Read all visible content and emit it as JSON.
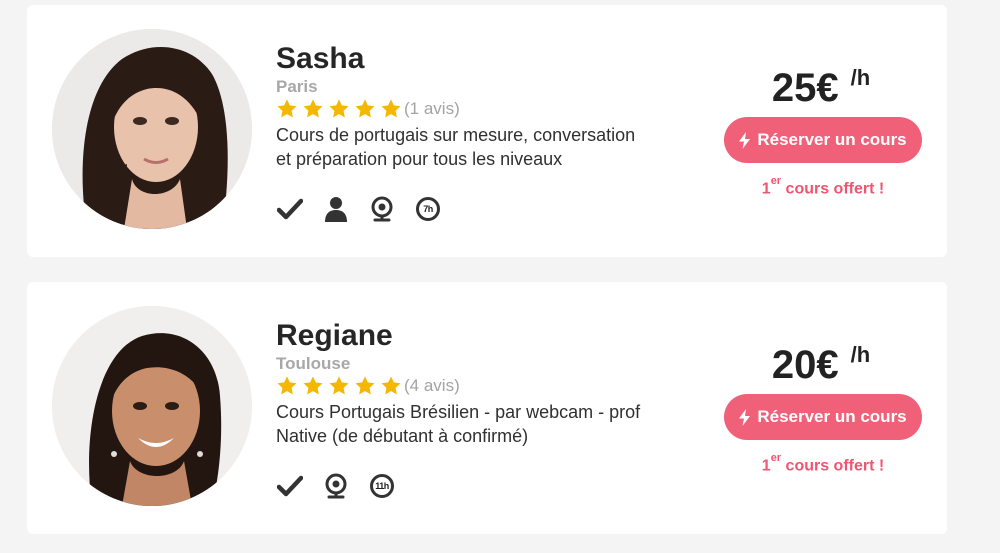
{
  "tutors": [
    {
      "name": "Sasha",
      "city": "Paris",
      "rating": 5,
      "reviews": "(1 avis)",
      "description": "Cours de portugais sur mesure, conversation\net préparation pour tous les niveaux",
      "features": [
        "check-icon",
        "person-icon",
        "webcam-icon",
        "hours-badge"
      ],
      "hours": "7h",
      "price": "25€",
      "price_unit": "/h",
      "book_label": "Réserver un cours",
      "offer_prefix": "1",
      "offer_sup": "er",
      "offer_text": " cours offert !"
    },
    {
      "name": "Regiane",
      "city": "Toulouse",
      "rating": 5,
      "reviews": "(4 avis)",
      "description": "Cours Portugais Brésilien - par webcam - prof\nNative (de débutant à confirmé)",
      "features": [
        "check-icon",
        "webcam-icon",
        "hours-badge"
      ],
      "hours": "11h",
      "price": "20€",
      "price_unit": "/h",
      "book_label": "Réserver un cours",
      "offer_prefix": "1",
      "offer_sup": "er",
      "offer_text": " cours offert !"
    }
  ],
  "colors": {
    "accent": "#f06179",
    "offer": "#ee5670",
    "star": "#f5b800",
    "muted": "#a8a8a8"
  }
}
